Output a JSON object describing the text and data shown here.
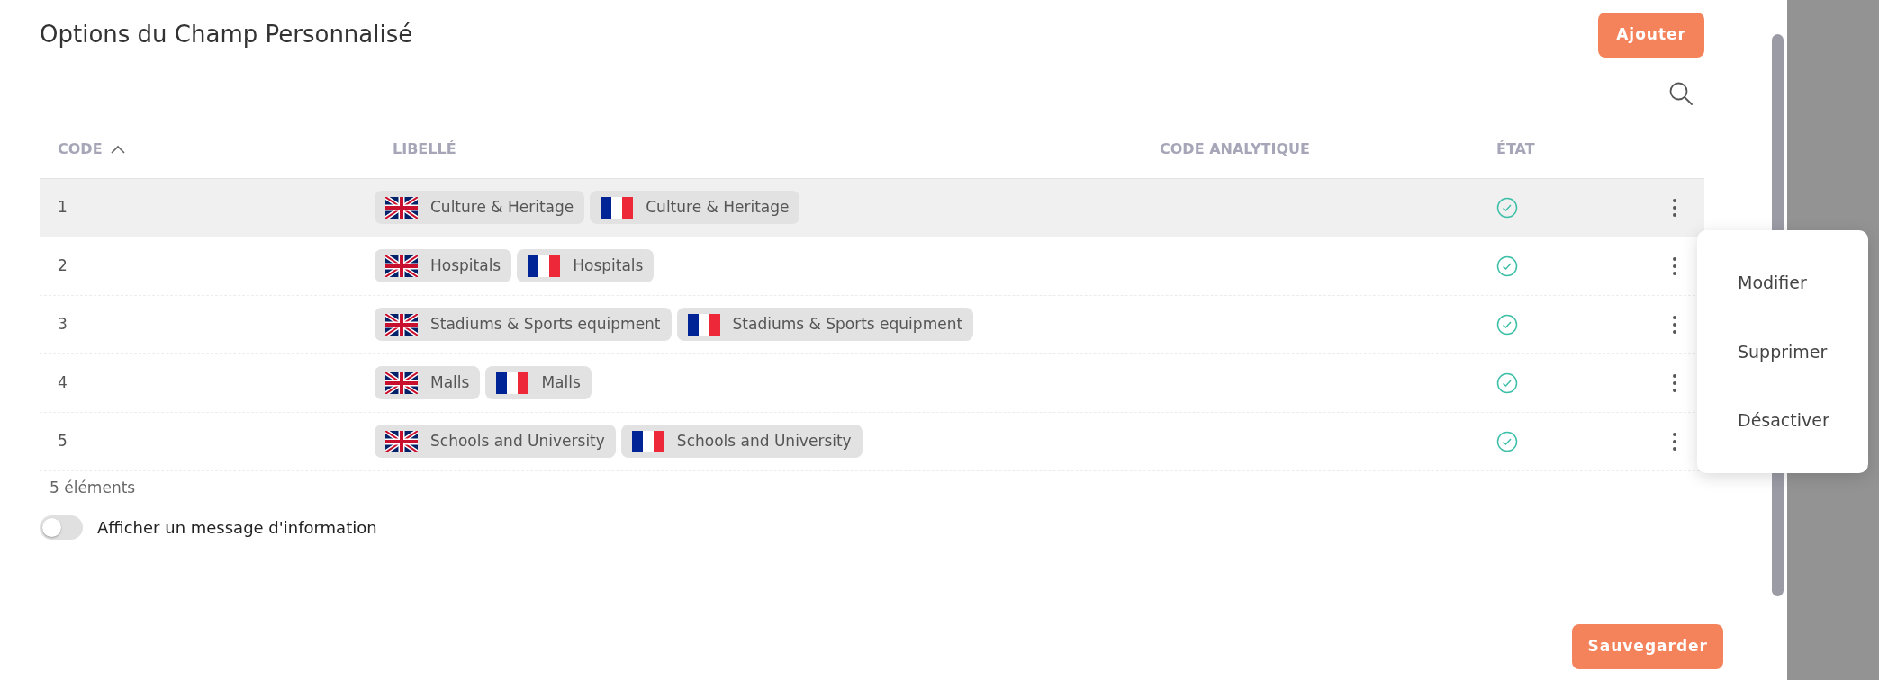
{
  "dialog": {
    "title": "Options du Champ Personnalisé",
    "add_button": "Ajouter"
  },
  "table": {
    "columns": [
      {
        "label": "CODE",
        "sorted": true
      },
      {
        "label": "LIBELLÉ"
      },
      {
        "label": "CODE ANALYTIQUE"
      },
      {
        "label": "ÉTAT"
      }
    ],
    "rows": [
      {
        "code": "1",
        "labels": [
          {
            "kind": "uk",
            "text": "Culture & Heritage"
          },
          {
            "kind": "france",
            "text": "Culture & Heritage"
          }
        ],
        "active": true,
        "highlighted": true
      },
      {
        "code": "2",
        "labels": [
          {
            "kind": "uk",
            "text": "Hospitals"
          },
          {
            "kind": "france",
            "text": "Hospitals"
          }
        ],
        "active": true,
        "highlighted": false
      },
      {
        "code": "3",
        "labels": [
          {
            "kind": "uk",
            "text": "Stadiums & Sports equipment"
          },
          {
            "kind": "france",
            "text": "Stadiums & Sports equipment"
          }
        ],
        "active": true,
        "highlighted": false
      },
      {
        "code": "4",
        "labels": [
          {
            "kind": "uk",
            "text": "Malls"
          },
          {
            "kind": "france",
            "text": "Malls"
          }
        ],
        "active": true,
        "highlighted": false
      },
      {
        "code": "5",
        "labels": [
          {
            "kind": "uk",
            "text": "Schools and University"
          },
          {
            "kind": "france",
            "text": "Schools and University"
          }
        ],
        "active": true,
        "highlighted": false
      }
    ],
    "count": "5 éléments"
  },
  "context_menu": {
    "items": [
      "Modifier",
      "Supprimer",
      "Désactiver"
    ]
  },
  "info_toggle": {
    "label": "Afficher un message d'information",
    "on": false
  },
  "save_button": "Sauvegarder"
}
